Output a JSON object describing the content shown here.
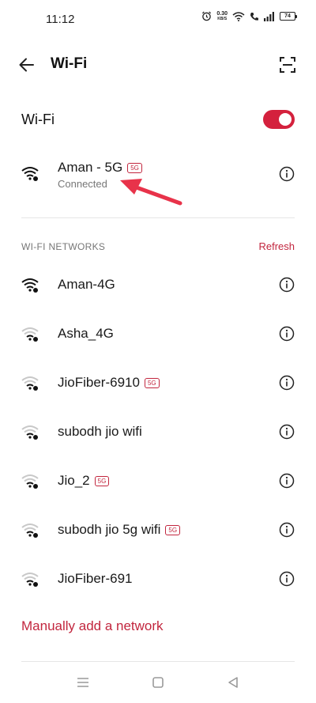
{
  "status_bar": {
    "time": "11:12",
    "speed_value": "0.30",
    "speed_unit": "KB/S",
    "battery": "74"
  },
  "header": {
    "title": "Wi-Fi"
  },
  "wifi_toggle": {
    "label": "Wi-Fi",
    "on": true
  },
  "connected_network": {
    "name": "Aman - 5G",
    "badge": "5G",
    "status": "Connected"
  },
  "networks_section": {
    "title": "WI-FI NETWORKS",
    "refresh_label": "Refresh"
  },
  "networks": [
    {
      "name": "Aman-4G",
      "badge": "",
      "signal": "full"
    },
    {
      "name": "Asha_4G",
      "badge": "",
      "signal": "weak"
    },
    {
      "name": "JioFiber-6910",
      "badge": "5G",
      "signal": "weak"
    },
    {
      "name": "subodh jio wifi",
      "badge": "",
      "signal": "weak"
    },
    {
      "name": "Jio_2",
      "badge": "5G",
      "signal": "weak"
    },
    {
      "name": "subodh jio 5g wifi",
      "badge": "5G",
      "signal": "weak"
    },
    {
      "name": "JioFiber-691",
      "badge": "",
      "signal": "weak"
    }
  ],
  "add_network_label": "Manually add a network",
  "colors": {
    "accent": "#c2263e",
    "toggle_on": "#d4213d",
    "arrow": "#e8334a"
  }
}
